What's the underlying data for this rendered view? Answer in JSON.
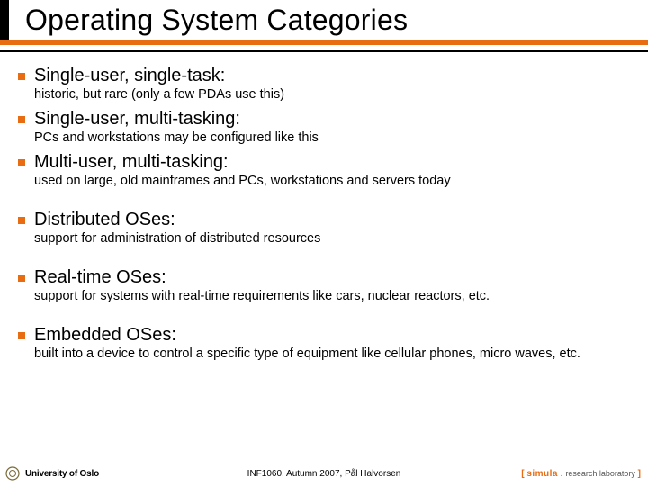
{
  "title": "Operating System Categories",
  "items": [
    {
      "term": "Single-user, single-task:",
      "desc": "historic, but rare (only a few PDAs use this)",
      "gap": false
    },
    {
      "term": "Single-user, multi-tasking:",
      "desc": "PCs and workstations may be configured like this",
      "gap": false
    },
    {
      "term": "Multi-user, multi-tasking:",
      "desc": "used on large, old mainframes and PCs, workstations and servers today",
      "gap": false
    },
    {
      "term": "Distributed OSes:",
      "desc": "support for administration of distributed resources",
      "gap": true
    },
    {
      "term": "Real-time OSes:",
      "desc": "support for systems with real-time requirements like cars, nuclear reactors, etc.",
      "gap": true
    },
    {
      "term": "Embedded OSes:",
      "desc": "built into a device to control a specific type of equipment like cellular phones, micro waves, etc.",
      "gap": true
    }
  ],
  "footer": {
    "university": "University of Oslo",
    "course": "INF1060, Autumn 2007, Pål Halvorsen",
    "simula": {
      "open": "[ ",
      "name": "simula",
      "dot": " . ",
      "rest": "research laboratory",
      "close": " ]"
    }
  }
}
